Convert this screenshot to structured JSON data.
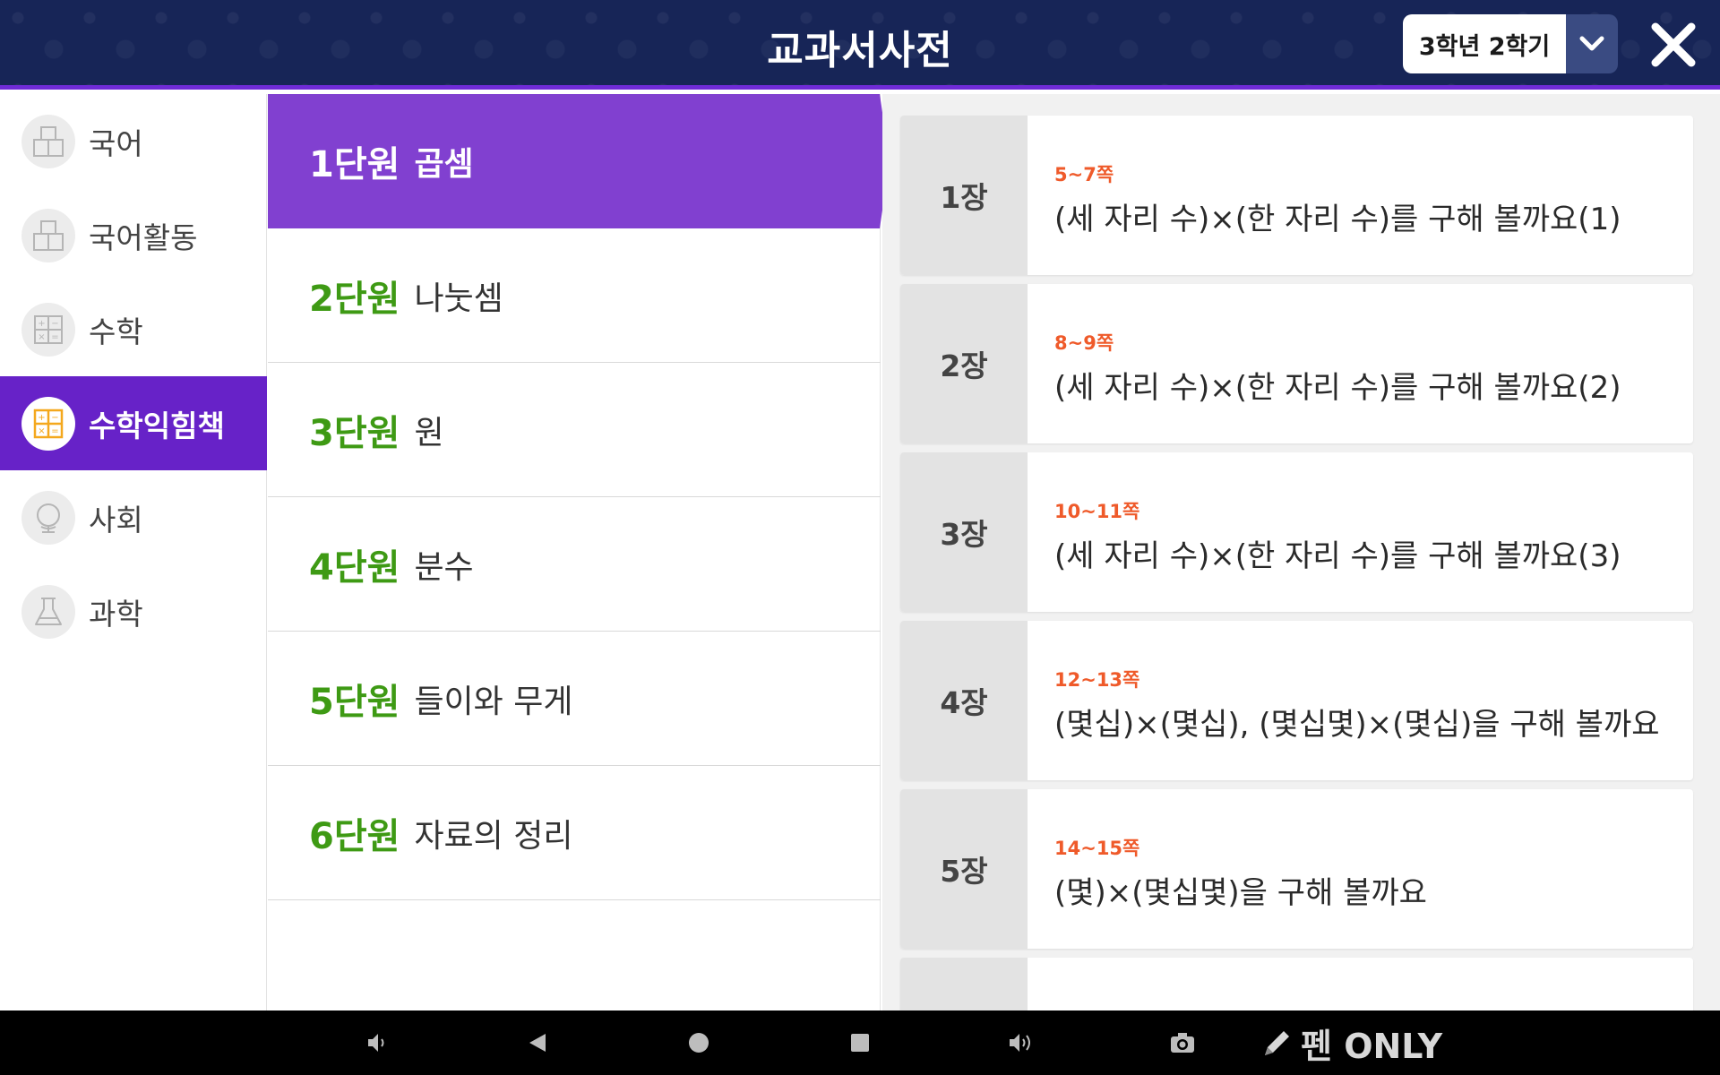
{
  "header": {
    "title": "교과서사전",
    "grade_selected": "3학년 2학기"
  },
  "subjects": [
    {
      "label": "국어",
      "icon": "korean-book-icon",
      "active": false
    },
    {
      "label": "국어활동",
      "icon": "korean-activity-icon",
      "active": false
    },
    {
      "label": "수학",
      "icon": "math-grid-icon",
      "active": false
    },
    {
      "label": "수학익힘책",
      "icon": "math-workbook-icon",
      "active": true
    },
    {
      "label": "사회",
      "icon": "globe-icon",
      "active": false
    },
    {
      "label": "과학",
      "icon": "flask-icon",
      "active": false
    }
  ],
  "units": [
    {
      "num": "1단원",
      "name": "곱셈",
      "active": true
    },
    {
      "num": "2단원",
      "name": "나눗셈",
      "active": false
    },
    {
      "num": "3단원",
      "name": "원",
      "active": false
    },
    {
      "num": "4단원",
      "name": "분수",
      "active": false
    },
    {
      "num": "5단원",
      "name": "들이와 무게",
      "active": false
    },
    {
      "num": "6단원",
      "name": "자료의 정리",
      "active": false
    }
  ],
  "chapters": [
    {
      "num": "1장",
      "pages": "5~7쪽",
      "title": "(세 자리 수)×(한 자리 수)를 구해 볼까요(1)"
    },
    {
      "num": "2장",
      "pages": "8~9쪽",
      "title": "(세 자리 수)×(한 자리 수)를 구해 볼까요(2)"
    },
    {
      "num": "3장",
      "pages": "10~11쪽",
      "title": "(세 자리 수)×(한 자리 수)를 구해 볼까요(3)"
    },
    {
      "num": "4장",
      "pages": "12~13쪽",
      "title": "(몇십)×(몇십), (몇십몇)×(몇십)을 구해 볼까요"
    },
    {
      "num": "5장",
      "pages": "14~15쪽",
      "title": "(몇)×(몇십몇)을 구해 볼까요"
    }
  ],
  "system_bar": {
    "pen_label": "펜 ONLY",
    "icons": [
      "volume-down-icon",
      "back-icon",
      "home-icon",
      "recents-icon",
      "volume-up-icon",
      "camera-icon",
      "pen-icon"
    ]
  },
  "colors": {
    "header_bg": "#172557",
    "accent_purple": "#6722c8",
    "unit_active": "#8140d0",
    "unit_number_green": "#3e9a14",
    "page_orange": "#ef5a2a"
  }
}
